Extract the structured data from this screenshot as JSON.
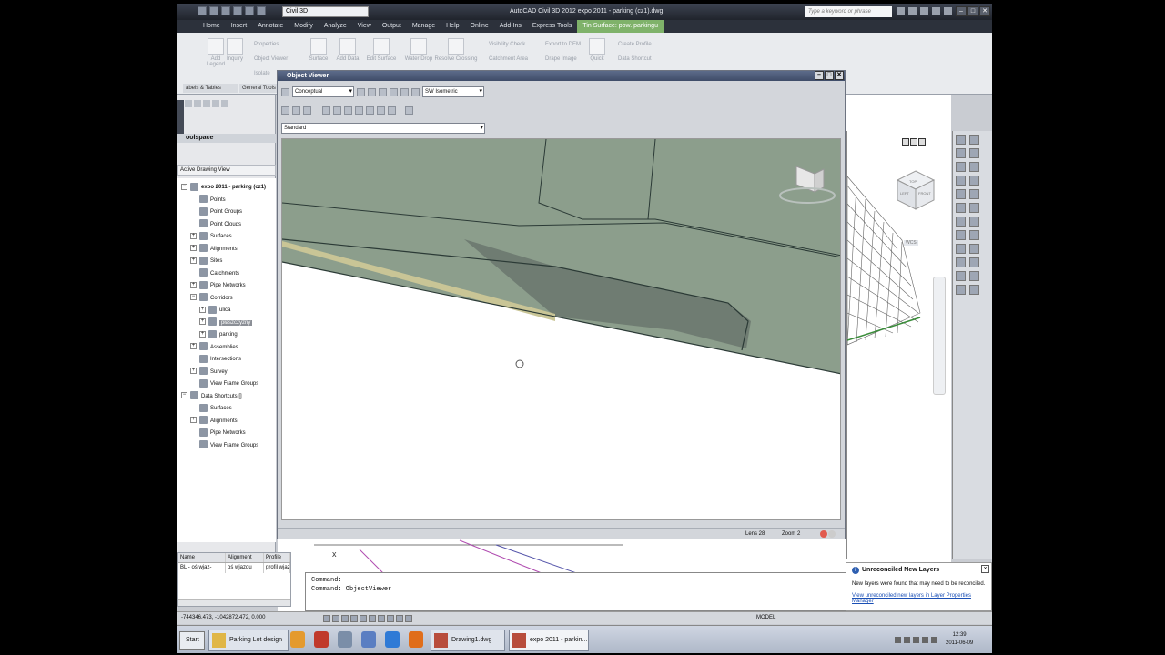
{
  "app": {
    "title": "AutoCAD Civil 3D 2012   expo 2011 - parking (cz1).dwg",
    "workspace": "Civil 3D",
    "search_placeholder": "Type a keyword or phrase"
  },
  "ribbon": {
    "tabs": [
      "Home",
      "Insert",
      "Annotate",
      "Modify",
      "Analyze",
      "View",
      "Output",
      "Manage",
      "Help",
      "Online",
      "Add-Ins",
      "Express Tools",
      "Tin Surface: pow. parkingu"
    ],
    "buttons": {
      "add_legend": "Add Legend",
      "inquiry": "Inquiry",
      "properties": "Properties",
      "object_viewer": "Object Viewer",
      "isolate": "Isolate",
      "surface": "Surface",
      "add_data": "Add Data",
      "edit_surface": "Edit Surface",
      "water_drop": "Water Drop",
      "resolve_crossing": "Resolve Crossing",
      "visibility_check": "Visibility Check",
      "catchment_area": "Catchment Area",
      "export_dem": "Export to DEM",
      "drape_image": "Drape Image",
      "quick": "Quick",
      "create_profile": "Create Profile",
      "data_shortcut": "Data Shortcut"
    },
    "panels": {
      "labels_tables": "abels & Tables",
      "general_tools": "General Tools"
    }
  },
  "prospector": {
    "toolspace_label": "oolspace",
    "view": "Active Drawing View",
    "tree": [
      {
        "label": "expo 2011 - parking (cz1)",
        "level": 0,
        "expander": "−",
        "bold": true
      },
      {
        "label": "Points",
        "level": 1,
        "expander": ""
      },
      {
        "label": "Point Groups",
        "level": 1,
        "expander": ""
      },
      {
        "label": "Point Clouds",
        "level": 1,
        "expander": ""
      },
      {
        "label": "Surfaces",
        "level": 1,
        "expander": "+"
      },
      {
        "label": "Alignments",
        "level": 1,
        "expander": "+"
      },
      {
        "label": "Sites",
        "level": 1,
        "expander": "+"
      },
      {
        "label": "Catchments",
        "level": 1,
        "expander": ""
      },
      {
        "label": "Pipe Networks",
        "level": 1,
        "expander": "+"
      },
      {
        "label": "Corridors",
        "level": 1,
        "expander": "−"
      },
      {
        "label": "ulica",
        "level": 2,
        "expander": "+"
      },
      {
        "label": "płaszczyzny",
        "level": 2,
        "expander": "+",
        "selected": true
      },
      {
        "label": "parking",
        "level": 2,
        "expander": "+"
      },
      {
        "label": "Assemblies",
        "level": 1,
        "expander": "+"
      },
      {
        "label": "Intersections",
        "level": 1,
        "expander": ""
      },
      {
        "label": "Survey",
        "level": 1,
        "expander": "+"
      },
      {
        "label": "View Frame Groups",
        "level": 1,
        "expander": ""
      },
      {
        "label": "Data Shortcuts []",
        "level": 0,
        "expander": "−"
      },
      {
        "label": "Surfaces",
        "level": 1,
        "expander": ""
      },
      {
        "label": "Alignments",
        "level": 1,
        "expander": "+"
      },
      {
        "label": "Pipe Networks",
        "level": 1,
        "expander": ""
      },
      {
        "label": "View Frame Groups",
        "level": 1,
        "expander": ""
      }
    ]
  },
  "table": {
    "headers": [
      "Name",
      "Alignment",
      "Profile"
    ],
    "rows": [
      [
        "BL - oś wjaz-",
        "oś wjazdu",
        "profil wjaz"
      ]
    ]
  },
  "coordinates": "-744346.473, -1042872.472, 0.000",
  "object_viewer": {
    "title": "Object Viewer",
    "visual_style": "Conceptual",
    "view": "SW Isometric",
    "style": "Standard",
    "lens": "Lens 28",
    "zoom": "Zoom 2"
  },
  "viewcube": {
    "top": "TOP",
    "front": "FRONT",
    "left": "LEFT",
    "wcs": "WCS"
  },
  "command": {
    "lines": [
      "Command:",
      "Command: ObjectViewer"
    ]
  },
  "status": {
    "model": "MODEL"
  },
  "notification": {
    "title": "Unreconciled New Layers",
    "body": "New layers were found that may need to be reconciled.",
    "link": "View unreconciled new layers in Layer Properties Manager"
  },
  "taskbar": {
    "start": "Start",
    "items": [
      "Parking Lot design",
      "Drawing1.dwg",
      "expo 2011 - parkin..."
    ],
    "clock_time": "12:39",
    "clock_date": "2011-06-09"
  },
  "colors": {
    "surface": "#8c9e8c",
    "surface_shadow": "#6f7c72",
    "edge_band": "#c9c596",
    "context_tab": "#7fb26a",
    "accent": "#2e5fb0"
  }
}
